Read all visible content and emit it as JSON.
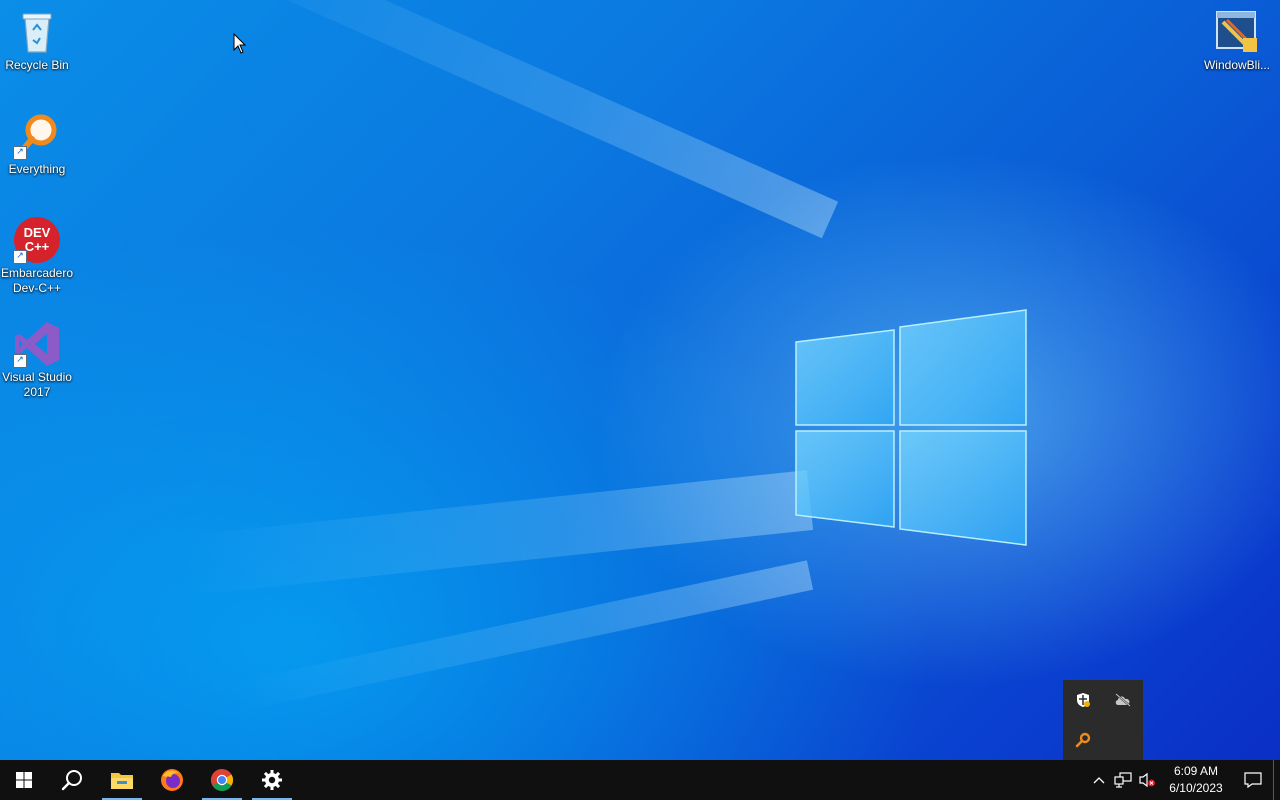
{
  "desktop": {
    "icons": [
      {
        "label": "Recycle Bin"
      },
      {
        "label": "Everything"
      },
      {
        "label": "Embarcadero\nDev-C++"
      },
      {
        "label": "Visual Studio\n2017"
      },
      {
        "label": "WindowBli..."
      }
    ]
  },
  "taskbar": {
    "buttons": [
      {
        "name": "start-icon"
      },
      {
        "name": "search-icon"
      },
      {
        "name": "file-explorer-icon",
        "active": true
      },
      {
        "name": "firefox-icon",
        "active": false
      },
      {
        "name": "chrome-icon",
        "active": true
      },
      {
        "name": "settings-icon",
        "active": true
      }
    ],
    "clock": {
      "time": "6:09 AM",
      "date": "6/10/2023"
    }
  },
  "tray_popup": {
    "icons": [
      "windows-security-icon",
      "onedrive-offline-icon",
      "everything-search-icon"
    ]
  },
  "colors": {
    "taskbar": "#101010",
    "accent_underline": "#7ab7f0",
    "tray_popup": "#2b2b2b"
  }
}
